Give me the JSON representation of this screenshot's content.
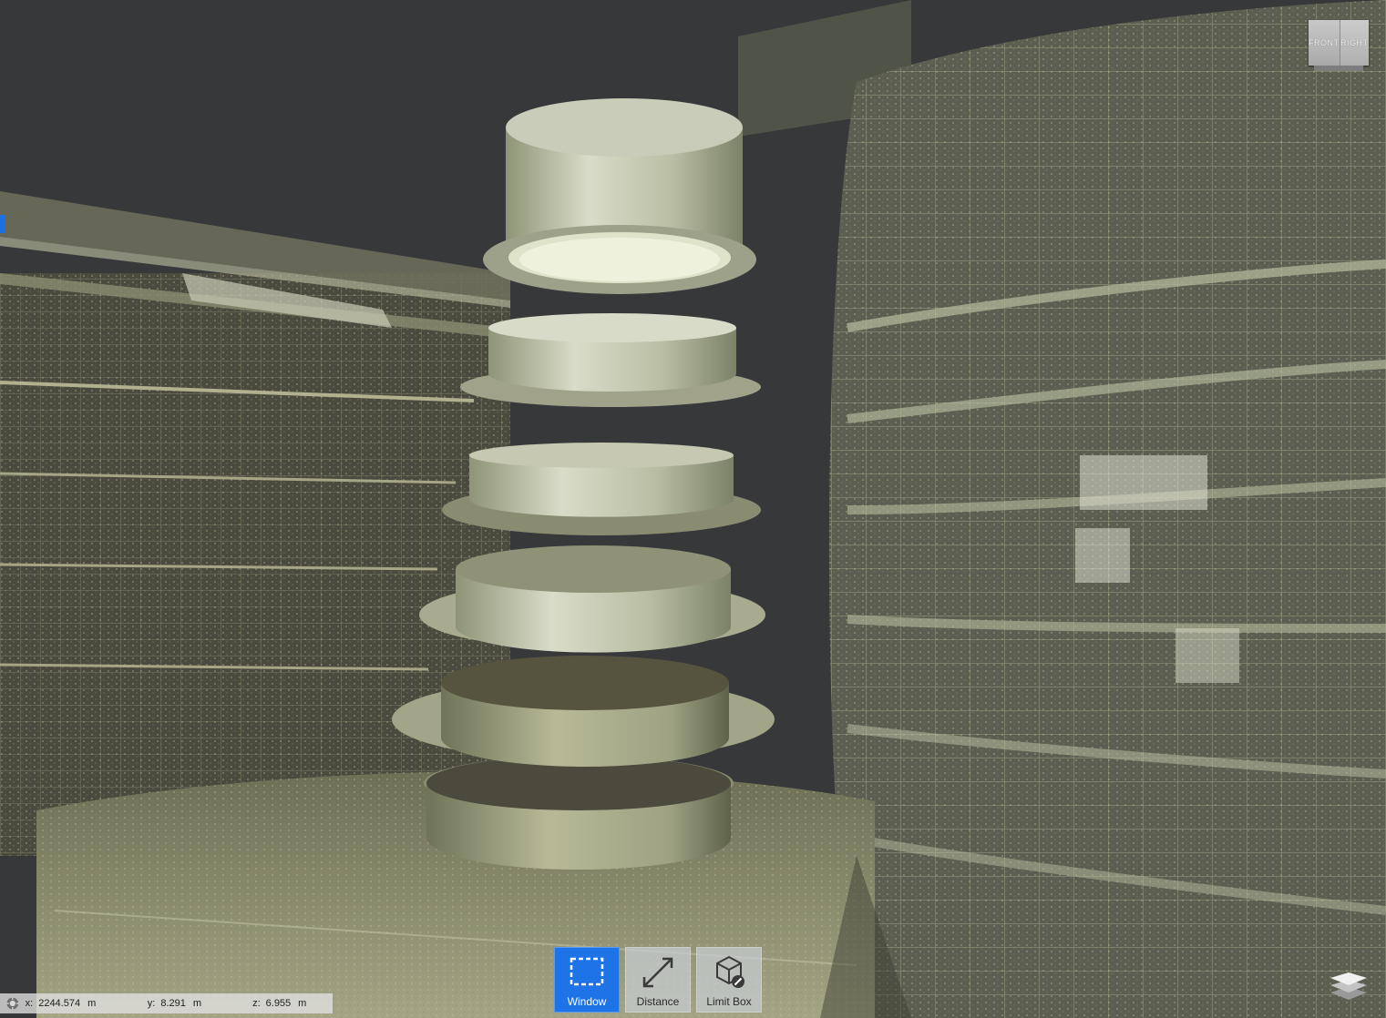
{
  "view_cube": {
    "front_label": "FRONT",
    "right_label": "RIGHT"
  },
  "toolbar": {
    "tools": [
      {
        "label": "Window",
        "icon": "window-select-icon",
        "active": true
      },
      {
        "label": "Distance",
        "icon": "distance-measure-icon",
        "active": false
      },
      {
        "label": "Limit Box",
        "icon": "limit-box-icon",
        "active": false
      }
    ]
  },
  "coordinates": {
    "x": {
      "key": "x:",
      "value": "2244.574",
      "unit": "m"
    },
    "y": {
      "key": "y:",
      "value": "8.291",
      "unit": "m"
    },
    "z": {
      "key": "z:",
      "value": "6.955",
      "unit": "m"
    }
  },
  "colors": {
    "background": "#36383a",
    "active_tool": "#1e73e6",
    "point_cloud_tint": "#c9caa6"
  }
}
